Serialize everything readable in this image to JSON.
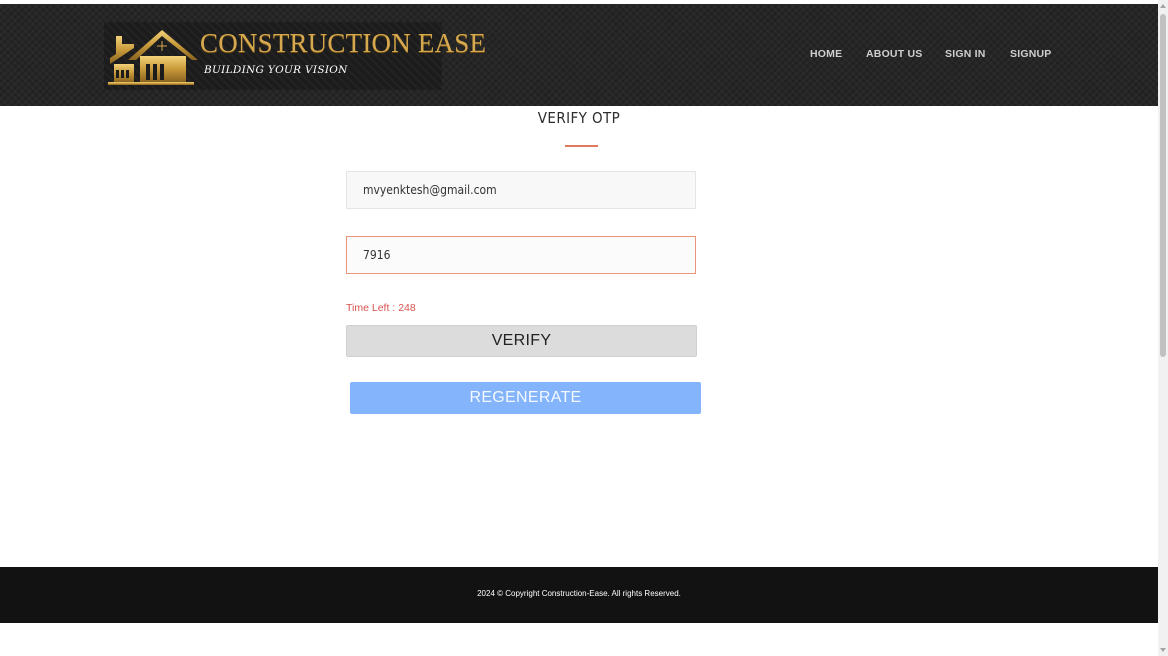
{
  "brand": {
    "title": "CONSTRUCTION EASE",
    "tagline": "BUILDING YOUR VISION",
    "logo_icon": "house-icon"
  },
  "nav": {
    "items": [
      {
        "label": "HOME"
      },
      {
        "label": "ABOUT US"
      },
      {
        "label": "SIGN IN"
      },
      {
        "label": "SIGNUP"
      }
    ]
  },
  "form": {
    "title": "VERIFY OTP",
    "email_value": "mvyenktesh@gmail.com",
    "otp_value": "7916",
    "timer_label": "Time Left :",
    "timer_value": "248",
    "verify_label": "VERIFY",
    "regenerate_label": "REGENERATE"
  },
  "footer": {
    "text": "2024 © Copyright Construction-Ease. All rights Reserved."
  },
  "colors": {
    "header_bg": "#262626",
    "brand_gold": "#d6a94e",
    "accent": "#e07a5f",
    "timer": "#d9534f",
    "regenerate_bg": "#84b4fb",
    "footer_bg": "#121212"
  }
}
